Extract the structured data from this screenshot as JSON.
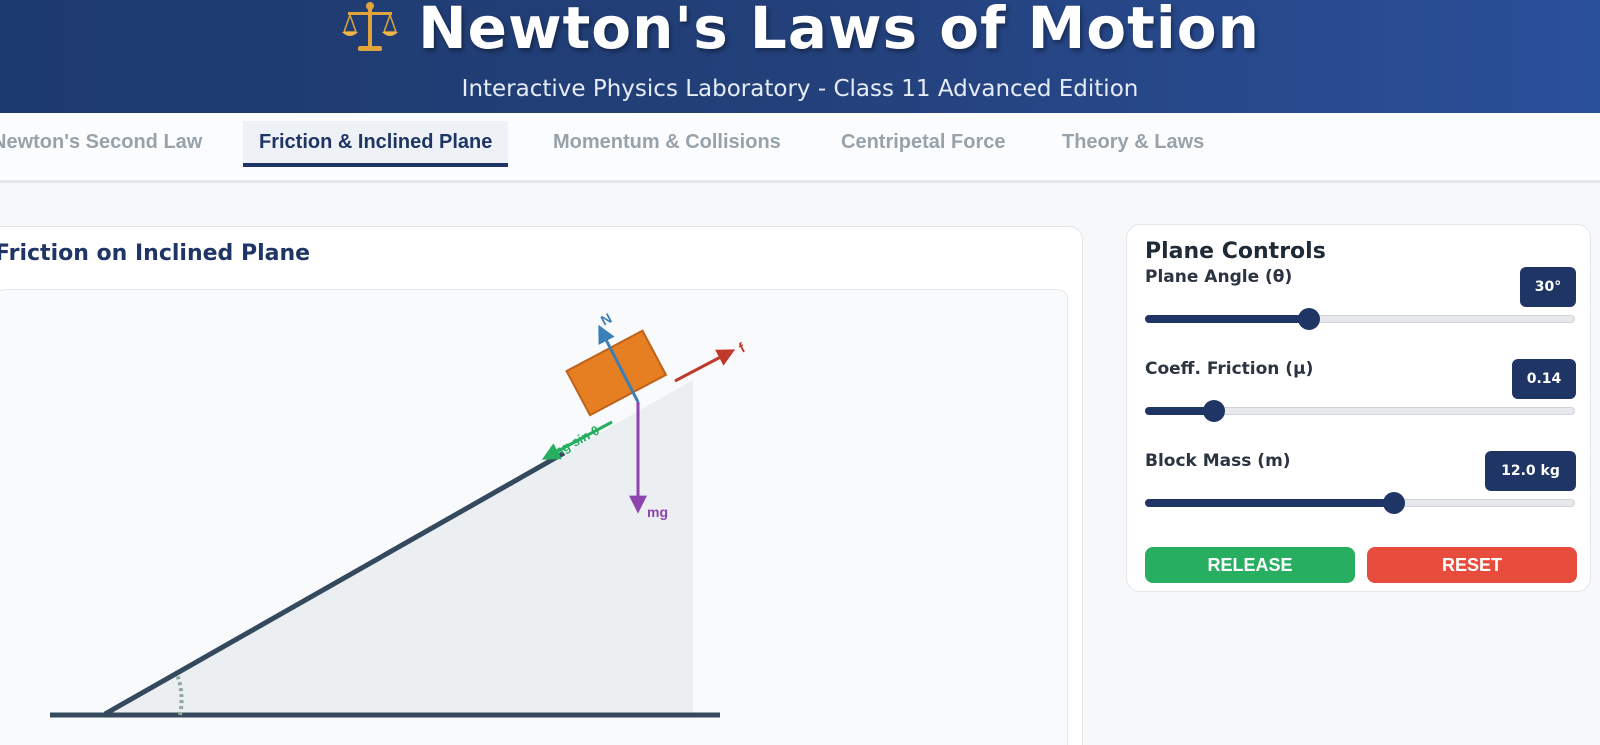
{
  "header": {
    "title": "Newton's Laws of Motion",
    "subtitle": "Interactive Physics Laboratory - Class 11 Advanced Edition",
    "icon": "balance-scale-icon"
  },
  "tabs": [
    {
      "label": "Newton's Second Law",
      "active": false
    },
    {
      "label": "Friction & Inclined Plane",
      "active": true
    },
    {
      "label": "Momentum & Collisions",
      "active": false
    },
    {
      "label": "Centripetal Force",
      "active": false
    },
    {
      "label": "Theory & Laws",
      "active": false
    }
  ],
  "simulation": {
    "title": "Friction on Inclined Plane",
    "labels": {
      "normal": "N",
      "friction": "f",
      "weight": "mg",
      "parallel": "mg sin θ"
    },
    "colors": {
      "normal": "#3a7fb5",
      "friction": "#c0392b",
      "weight": "#8e44ad",
      "parallel": "#27ae60",
      "block": "#e67e22"
    }
  },
  "controls": {
    "title": "Plane Controls",
    "angle": {
      "label": "Plane Angle (θ)",
      "value": "30°",
      "fraction": 0.38
    },
    "friction": {
      "label": "Coeff. Friction (μ)",
      "value": "0.14",
      "fraction": 0.16
    },
    "mass": {
      "label": "Block Mass (m)",
      "value": "12.0 kg",
      "fraction": 0.58
    },
    "release_label": "RELEASE",
    "reset_label": "RESET"
  }
}
